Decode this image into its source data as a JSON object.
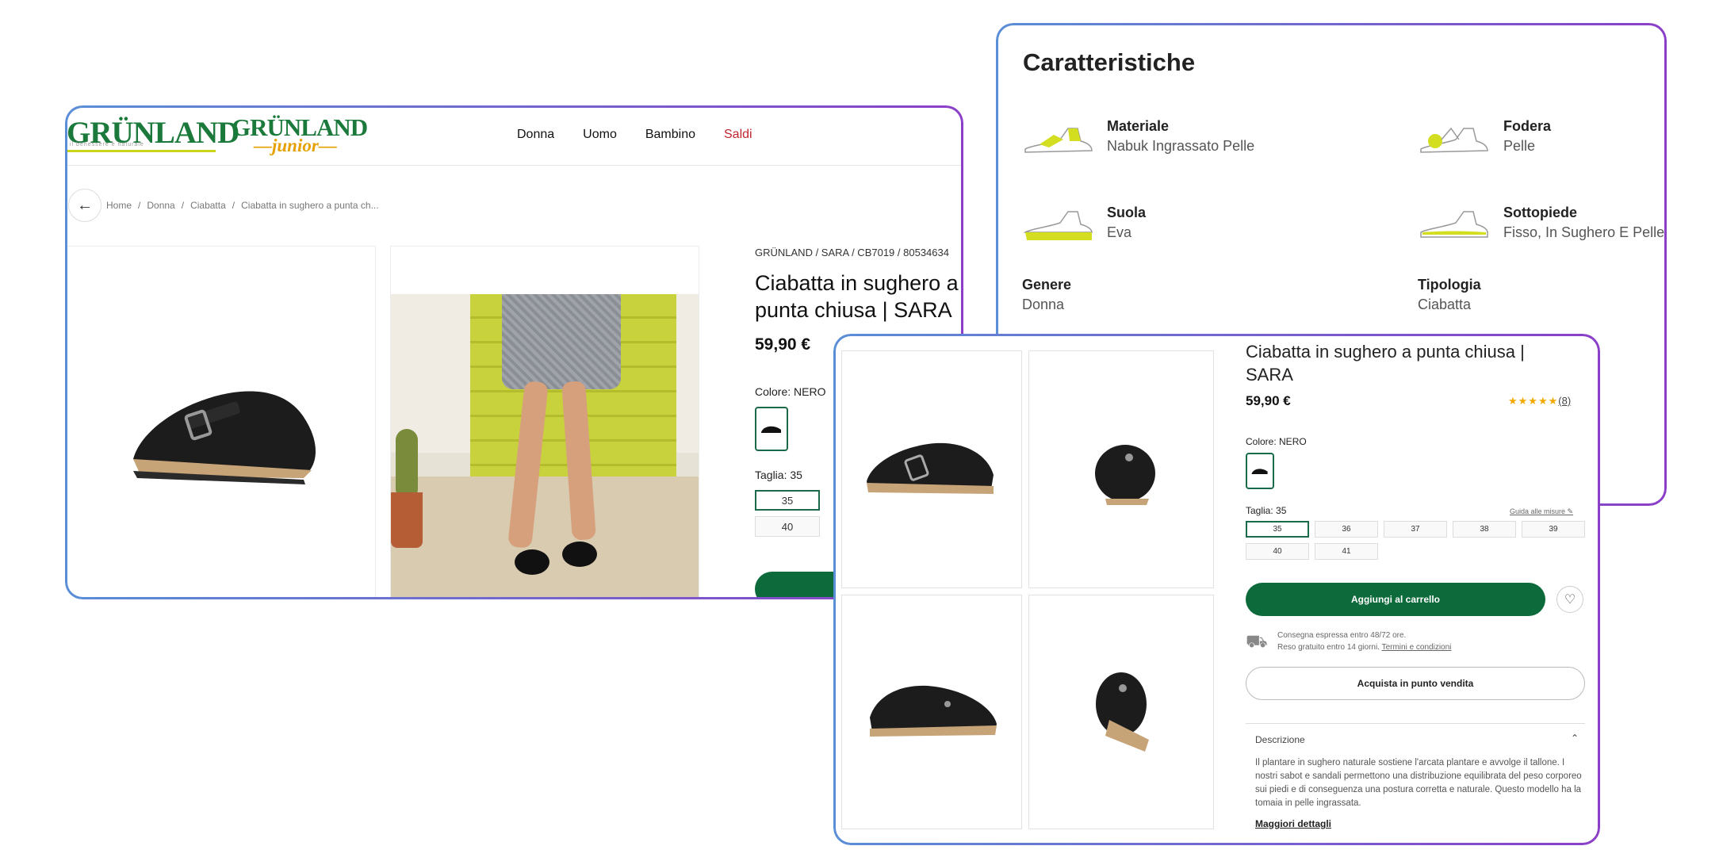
{
  "brand": {
    "logo_main": "GRÜNLAND",
    "logo_main_tagline": "il benessere è naturale",
    "logo_junior": "GRÜNLAND",
    "logo_junior_sub": "—junior—"
  },
  "nav": {
    "items": [
      "Donna",
      "Uomo",
      "Bambino",
      "Saldi"
    ]
  },
  "breadcrumb": [
    "Home",
    "Donna",
    "Ciabatta",
    "Ciabatta in sughero a punta ch..."
  ],
  "product_card1": {
    "meta": "GRÜNLAND  /  SARA  /  CB7019  /  80534634",
    "title": "Ciabatta in sughero a punta chiusa | SARA",
    "price": "59,90 €",
    "color_label": "Colore: NERO",
    "size_label": "Taglia: 35",
    "sizes": [
      "35",
      "40"
    ]
  },
  "features": {
    "title": "Caratteristiche",
    "items": [
      {
        "key": "Materiale",
        "value": "Nabuk Ingrassato Pelle"
      },
      {
        "key": "Fodera",
        "value": "Pelle"
      },
      {
        "key": "Suola",
        "value": "Eva"
      },
      {
        "key": "Sottopiede",
        "value": "Fisso, In Sughero E Pelle"
      },
      {
        "key": "Genere",
        "value": "Donna"
      },
      {
        "key": "Tipologia",
        "value": "Ciabatta"
      }
    ]
  },
  "product_card3": {
    "title": "Ciabatta in sughero a punta chiusa | SARA",
    "price": "59,90 €",
    "rating_stars": "★★★★★",
    "rating_count": "(8)",
    "color_label": "Colore: NERO",
    "size_label": "Taglia: 35",
    "size_guide": "Guida alle misure",
    "sizes": [
      "35",
      "36",
      "37",
      "38",
      "39",
      "40",
      "41"
    ],
    "add_to_cart": "Aggiungi al carrello",
    "shipping_line1": "Consegna espressa entro 48/72 ore.",
    "shipping_line2": "Reso gratuito entro 14 giorni.",
    "shipping_link": "Termini e condizioni",
    "store_button": "Acquista in punto vendita",
    "description_heading": "Descrizione",
    "description_text": "Il plantare in sughero naturale sostiene l'arcata plantare e avvolge il tallone. I nostri sabot e sandali permettono una distribuzione equilibrata del peso corporeo sui piedi e di conseguenza una postura corretta e naturale. Questo modello ha la tomaia in pelle ingrassata.",
    "more_details": "Maggiori dettagli"
  },
  "colors": {
    "brand_green": "#0d6b3b",
    "sale_red": "#c0242e",
    "accent_yellow": "#c9d41b",
    "star": "#f2a900"
  },
  "icons": [
    "back-arrow-icon",
    "heart-icon",
    "truck-icon",
    "chevron-up-icon",
    "pencil-icon"
  ]
}
